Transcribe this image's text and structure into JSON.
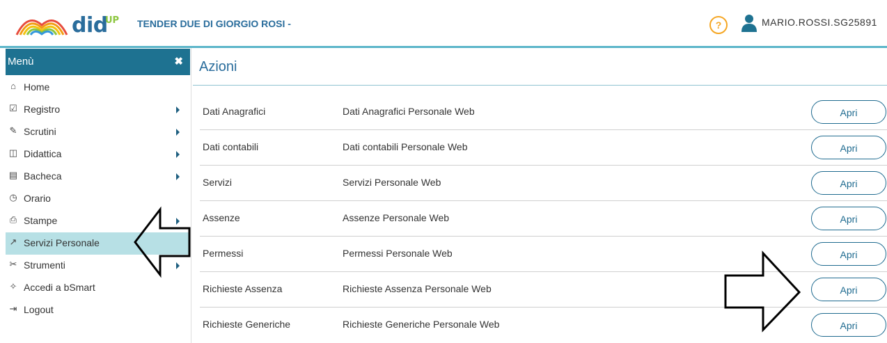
{
  "header": {
    "brand": "did",
    "brand_sup": "UP",
    "school": "TENDER DUE DI GIORGIO ROSI -",
    "help": "?",
    "username": "MARIO.ROSSI.SG25891"
  },
  "sidebar": {
    "title": "Menù",
    "close": "✖",
    "items": [
      {
        "label": "Home",
        "icon": "⌂"
      },
      {
        "label": "Registro",
        "icon": "☑"
      },
      {
        "label": "Scrutini",
        "icon": "✎"
      },
      {
        "label": "Didattica",
        "icon": "◫"
      },
      {
        "label": "Bacheca",
        "icon": "▤"
      },
      {
        "label": "Orario",
        "icon": "◷"
      },
      {
        "label": "Stampe",
        "icon": "⎙"
      },
      {
        "label": "Servizi Personale",
        "icon": "↗"
      },
      {
        "label": "Strumenti",
        "icon": "✂"
      },
      {
        "label": "Accedi a bSmart",
        "icon": "✧"
      },
      {
        "label": "Logout",
        "icon": "⇥"
      }
    ]
  },
  "main": {
    "title": "Azioni",
    "rows": [
      {
        "name": "Dati Anagrafici",
        "desc": "Dati Anagrafici Personale Web",
        "button": "Apri"
      },
      {
        "name": "Dati contabili",
        "desc": "Dati contabili Personale Web",
        "button": "Apri"
      },
      {
        "name": "Servizi",
        "desc": "Servizi Personale Web",
        "button": "Apri"
      },
      {
        "name": "Assenze",
        "desc": "Assenze Personale Web",
        "button": "Apri"
      },
      {
        "name": "Permessi",
        "desc": "Permessi Personale Web",
        "button": "Apri"
      },
      {
        "name": "Richieste Assenza",
        "desc": "Richieste Assenza Personale Web",
        "button": "Apri"
      },
      {
        "name": "Richieste Generiche",
        "desc": "Richieste Generiche Personale Web",
        "button": "Apri"
      }
    ]
  },
  "colors": {
    "accent": "#1e7291",
    "active_bg": "#b7e0e5",
    "help": "#f5a623",
    "brand": "#2a6d9c"
  }
}
